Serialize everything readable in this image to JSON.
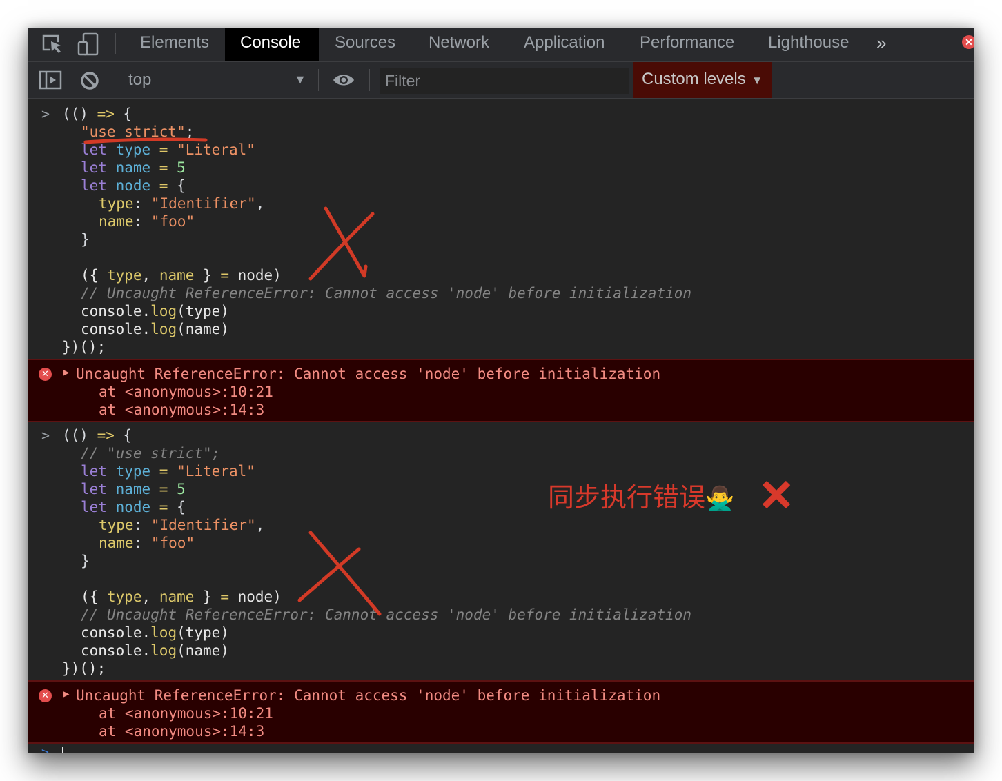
{
  "tabbar": {
    "tabs": [
      {
        "label": "Elements",
        "active": false
      },
      {
        "label": "Console",
        "active": true
      },
      {
        "label": "Sources",
        "active": false
      },
      {
        "label": "Network",
        "active": false
      },
      {
        "label": "Application",
        "active": false
      },
      {
        "label": "Performance",
        "active": false
      },
      {
        "label": "Lighthouse",
        "active": false
      }
    ],
    "more_tabs_glyph": "»",
    "error_badge_glyph": "✕",
    "icons": [
      "inspect-element-icon",
      "device-toolbar-icon"
    ]
  },
  "toolbar": {
    "context": "top",
    "context_arrow": "▼",
    "filter_placeholder": "Filter",
    "filter_value": "",
    "levels_label": "Custom levels",
    "levels_arrow": "▼",
    "icons": [
      "sidebar-toggle-icon",
      "clear-console-icon",
      "live-expression-eye-icon"
    ]
  },
  "console": {
    "prompt_glyph": ">",
    "entries": [
      {
        "lines": {
          "l1": {
            "a": "((",
            "b": ")",
            "arrow": " =>",
            "c": " {"
          },
          "l2": {
            "str": "\"use strict\"",
            "semi": ";"
          },
          "l3": {
            "kw": "let",
            "var": " type",
            "eq": " =",
            "str": " \"Literal\""
          },
          "l4": {
            "kw": "let",
            "var": " name",
            "eq": " =",
            "num": " 5"
          },
          "l5": {
            "kw": "let",
            "var": " node",
            "eq": " =",
            "brace": " {"
          },
          "l6": {
            "prop": "type",
            "colon": ":",
            "str": " \"Identifier\"",
            "comma": ","
          },
          "l7": {
            "prop": "name",
            "colon": ":",
            "str": " \"foo\""
          },
          "l8": {
            "brace": "}"
          },
          "l9": {
            "open": "({ ",
            "p1": "type",
            "comma": ", ",
            "p2": "name",
            "close": " } ",
            "eq": "=",
            "rest": " node)"
          },
          "l10": {
            "comment": "// Uncaught ReferenceError: Cannot access 'node' before initialization"
          },
          "l11": {
            "obj": "console.",
            "fn": "log",
            "args": "(type)"
          },
          "l12": {
            "obj": "console.",
            "fn": "log",
            "args": "(name)"
          },
          "l13": {
            "end": "})();"
          }
        }
      },
      {
        "lines": {
          "l1": {
            "a": "((",
            "b": ")",
            "arrow": " =>",
            "c": " {"
          },
          "l2": {
            "comment": "// \"use strict\";"
          },
          "l3": {
            "kw": "let",
            "var": " type",
            "eq": " =",
            "str": " \"Literal\""
          },
          "l4": {
            "kw": "let",
            "var": " name",
            "eq": " =",
            "num": " 5"
          },
          "l5": {
            "kw": "let",
            "var": " node",
            "eq": " =",
            "brace": " {"
          },
          "l6": {
            "prop": "type",
            "colon": ":",
            "str": " \"Identifier\"",
            "comma": ","
          },
          "l7": {
            "prop": "name",
            "colon": ":",
            "str": " \"foo\""
          },
          "l8": {
            "brace": "}"
          },
          "l9": {
            "open": "({ ",
            "p1": "type",
            "comma": ", ",
            "p2": "name",
            "close": " } ",
            "eq": "=",
            "rest": " node)"
          },
          "l10": {
            "comment": "// Uncaught ReferenceError: Cannot access 'node' before initialization"
          },
          "l11": {
            "obj": "console.",
            "fn": "log",
            "args": "(type)"
          },
          "l12": {
            "obj": "console.",
            "fn": "log",
            "args": "(name)"
          },
          "l13": {
            "end": "})();"
          }
        }
      }
    ],
    "errors": [
      {
        "icon": "✕",
        "expand": "▶",
        "message": "Uncaught ReferenceError: Cannot access 'node' before initialization",
        "stack": [
          "at <anonymous>:10:21",
          "at <anonymous>:14:3"
        ]
      },
      {
        "icon": "✕",
        "expand": "▶",
        "message": "Uncaught ReferenceError: Cannot access 'node' before initialization",
        "stack": [
          "at <anonymous>:10:21",
          "at <anonymous>:14:3"
        ]
      }
    ]
  },
  "annotations": {
    "note_text": "同步执行错误",
    "note_emoji": "🙅‍♂️",
    "note_color": "#d8392b",
    "mark_color": "#d23a26"
  },
  "colors": {
    "background": "#242424",
    "toolbar": "#292a2d",
    "active_tab": "#000000",
    "levels_bg": "#4a0b05",
    "error_bg": "#290000",
    "error_text": "#f28b82"
  }
}
